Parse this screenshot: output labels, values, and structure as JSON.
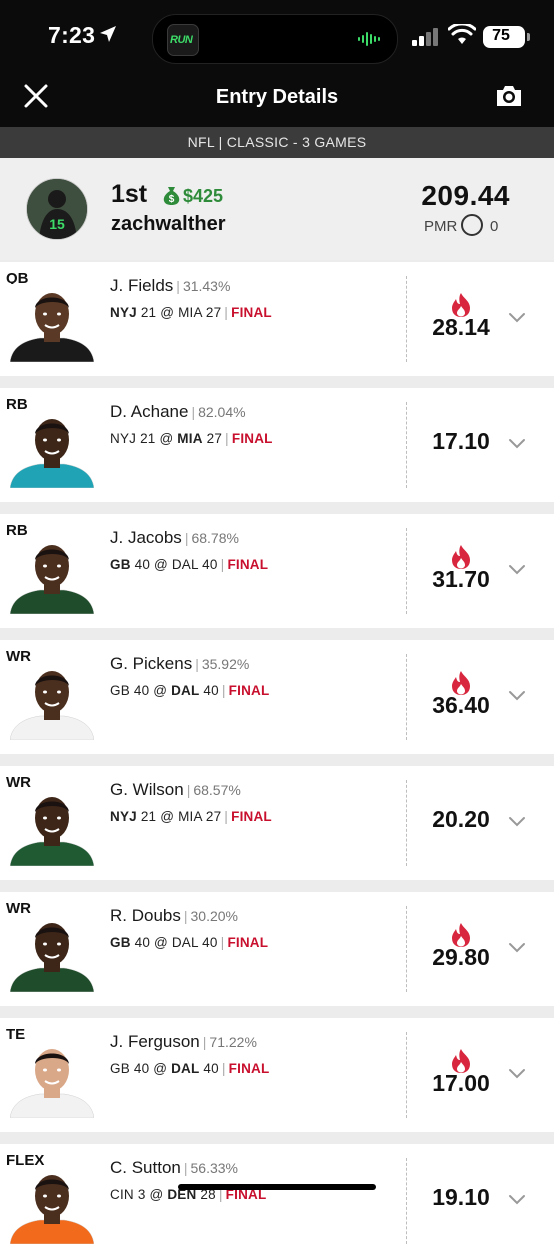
{
  "status_bar": {
    "time": "7:23",
    "island_app_text": "RUN",
    "battery": "75"
  },
  "header": {
    "title": "Entry Details",
    "contest_info": "NFL | CLASSIC - 3 GAMES"
  },
  "entry": {
    "rank": "1st",
    "winnings": "$425",
    "username": "zachwalther",
    "total_points": "209.44",
    "pmr_label": "PMR",
    "pmr_value": "0"
  },
  "players": [
    {
      "pos": "QB",
      "name": "J. Fields",
      "own": "31.43%",
      "team1": "NYJ",
      "score1": "21",
      "at": "@",
      "team2": "MIA",
      "score2": "27",
      "bold": 1,
      "status": "FINAL",
      "points": "28.14",
      "hot": true,
      "jersey": "#1a1a1a",
      "skin": "#5a3a26"
    },
    {
      "pos": "RB",
      "name": "D. Achane",
      "own": "82.04%",
      "team1": "NYJ",
      "score1": "21",
      "at": "@",
      "team2": "MIA",
      "score2": "27",
      "bold": 2,
      "status": "FINAL",
      "points": "17.10",
      "hot": false,
      "jersey": "#1fa3b5",
      "skin": "#3d2618"
    },
    {
      "pos": "RB",
      "name": "J. Jacobs",
      "own": "68.78%",
      "team1": "GB",
      "score1": "40",
      "at": "@",
      "team2": "DAL",
      "score2": "40",
      "bold": 1,
      "status": "FINAL",
      "points": "31.70",
      "hot": true,
      "jersey": "#1f4d2b",
      "skin": "#4a2e1e"
    },
    {
      "pos": "WR",
      "name": "G. Pickens",
      "own": "35.92%",
      "team1": "GB",
      "score1": "40",
      "at": "@",
      "team2": "DAL",
      "score2": "40",
      "bold": 2,
      "status": "FINAL",
      "points": "36.40",
      "hot": true,
      "jersey": "#f2f2f2",
      "skin": "#4a2e1e"
    },
    {
      "pos": "WR",
      "name": "G. Wilson",
      "own": "68.57%",
      "team1": "NYJ",
      "score1": "21",
      "at": "@",
      "team2": "MIA",
      "score2": "27",
      "bold": 1,
      "status": "FINAL",
      "points": "20.20",
      "hot": false,
      "jersey": "#1f5a33",
      "skin": "#3d2618"
    },
    {
      "pos": "WR",
      "name": "R. Doubs",
      "own": "30.20%",
      "team1": "GB",
      "score1": "40",
      "at": "@",
      "team2": "DAL",
      "score2": "40",
      "bold": 1,
      "status": "FINAL",
      "points": "29.80",
      "hot": true,
      "jersey": "#1f4d2b",
      "skin": "#3d2618"
    },
    {
      "pos": "TE",
      "name": "J. Ferguson",
      "own": "71.22%",
      "team1": "GB",
      "score1": "40",
      "at": "@",
      "team2": "DAL",
      "score2": "40",
      "bold": 2,
      "status": "FINAL",
      "points": "17.00",
      "hot": true,
      "jersey": "#f2f2f2",
      "skin": "#d9a888"
    },
    {
      "pos": "FLEX",
      "name": "C. Sutton",
      "own": "56.33%",
      "team1": "CIN",
      "score1": "3",
      "at": "@",
      "team2": "DEN",
      "score2": "28",
      "bold": 2,
      "status": "FINAL",
      "points": "19.10",
      "hot": false,
      "jersey": "#f26a1b",
      "skin": "#4a2e1e"
    }
  ]
}
